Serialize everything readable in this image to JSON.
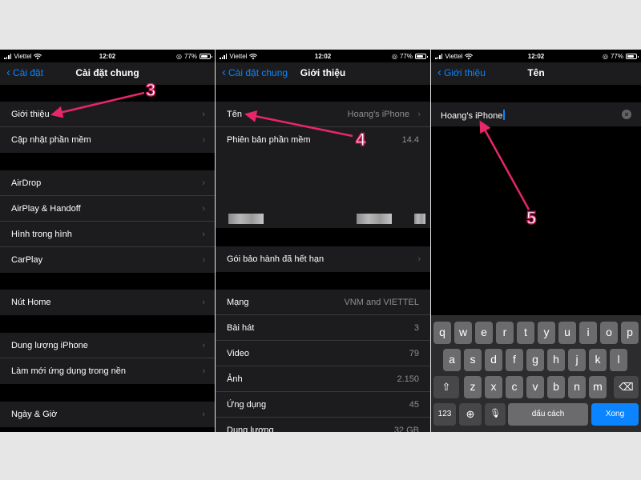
{
  "status": {
    "carrier": "Viettel",
    "time": "12:02",
    "battery": "77%",
    "battery_level": 0.77
  },
  "panel1": {
    "back_label": "Cài đặt",
    "title": "Cài đặt chung",
    "groups": [
      [
        "Giới thiệu",
        "Cập nhật phần mềm"
      ],
      [
        "AirDrop",
        "AirPlay & Handoff",
        "Hình trong hình",
        "CarPlay"
      ],
      [
        "Nút Home"
      ],
      [
        "Dung lượng iPhone",
        "Làm mới ứng dụng trong nền"
      ],
      [
        "Ngày & Giờ"
      ]
    ]
  },
  "panel2": {
    "back_label": "Cài đặt chung",
    "title": "Giới thiệu",
    "name_row": {
      "label": "Tên",
      "value": "Hoang's iPhone"
    },
    "version_row": {
      "label": "Phiên bản phần mềm",
      "value": "14.4"
    },
    "warranty_label": "Gói bảo hành đã hết hạn",
    "stats": [
      {
        "label": "Mạng",
        "value": "VNM and VIETTEL"
      },
      {
        "label": "Bài hát",
        "value": "3"
      },
      {
        "label": "Video",
        "value": "79"
      },
      {
        "label": "Ảnh",
        "value": "2.150"
      },
      {
        "label": "Ứng dụng",
        "value": "45"
      },
      {
        "label": "Dung lượng",
        "value": "32 GB"
      }
    ]
  },
  "panel3": {
    "back_label": "Giới thiệu",
    "title": "Tên",
    "name_value": "Hoang's iPhone",
    "keyboard": {
      "row1": [
        "q",
        "w",
        "e",
        "r",
        "t",
        "y",
        "u",
        "i",
        "o",
        "p"
      ],
      "row2": [
        "a",
        "s",
        "d",
        "f",
        "g",
        "h",
        "j",
        "k",
        "l"
      ],
      "row3": [
        "z",
        "x",
        "c",
        "v",
        "b",
        "n",
        "m"
      ],
      "numbers_key": "123",
      "space_key": "dấu cách",
      "done_key": "Xong"
    }
  },
  "annotations": {
    "step3": "3",
    "step4": "4",
    "step5": "5",
    "color": "#e8266a"
  }
}
